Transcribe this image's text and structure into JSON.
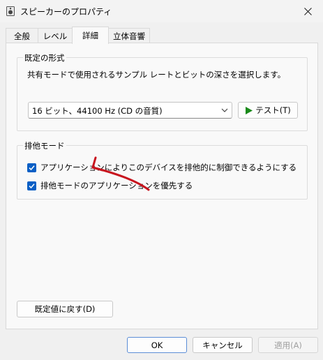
{
  "window": {
    "title": "スピーカーのプロパティ"
  },
  "tabs": [
    {
      "label": "全般",
      "active": false
    },
    {
      "label": "レベル",
      "active": false
    },
    {
      "label": "詳細",
      "active": true
    },
    {
      "label": "立体音響",
      "active": false
    }
  ],
  "default_format": {
    "group_label": "既定の形式",
    "description": "共有モードで使用されるサンプル レートとビットの深さを選択します。",
    "selected_value": "16 ビット、44100 Hz (CD の音質)",
    "test_button": "テスト(T)"
  },
  "exclusive_mode": {
    "group_label": "排他モード",
    "options": [
      {
        "label": "アプリケーションによりこのデバイスを排他的に制御できるようにする",
        "checked": true
      },
      {
        "label": "排他モードのアプリケーションを優先する",
        "checked": true
      }
    ]
  },
  "restore_button": "既定値に戻す(D)",
  "footer": {
    "ok": "OK",
    "cancel": "キャンセル",
    "apply": "適用(A)"
  },
  "colors": {
    "accent": "#0a5fc5",
    "play": "#1a8a1a",
    "annotation": "#c8141e"
  }
}
